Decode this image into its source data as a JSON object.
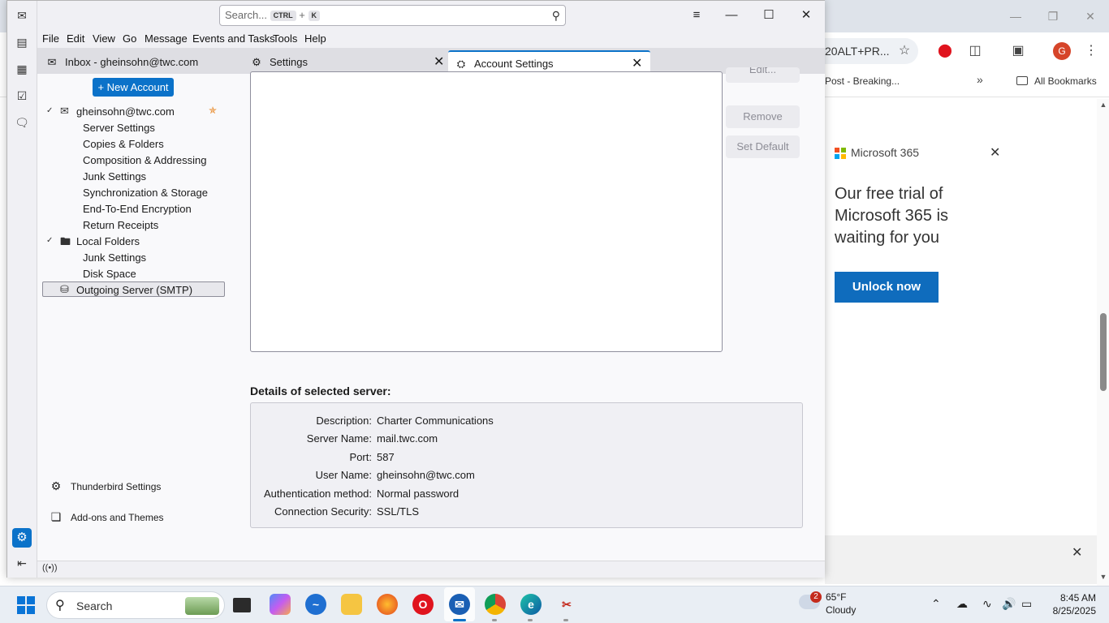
{
  "chrome": {
    "omnibox_text": "20ALT+PR...",
    "bookmark_post": "Post - Breaking...",
    "bookmark_more": "»",
    "bookmark_all": "All Bookmarks",
    "avatar_letter": "G",
    "ad": {
      "brand": "Microsoft 365",
      "headline": "Our free trial of Microsoft 365 is waiting for you",
      "cta": "Unlock now"
    }
  },
  "thunderbird": {
    "search": {
      "placeholder": "Search...",
      "key1": "CTRL",
      "plus": "+",
      "key2": "K"
    },
    "menu": [
      "File",
      "Edit",
      "View",
      "Go",
      "Message",
      "Events and Tasks",
      "Tools",
      "Help"
    ],
    "tabs": [
      {
        "label": "Inbox - gheinsohn@twc.com"
      },
      {
        "label": "Settings"
      },
      {
        "label": "Account Settings"
      }
    ],
    "new_account": "New Account",
    "tree": {
      "account": "gheinsohn@twc.com",
      "account_children": [
        "Server Settings",
        "Copies & Folders",
        "Composition & Addressing",
        "Junk Settings",
        "Synchronization & Storage",
        "End-To-End Encryption",
        "Return Receipts"
      ],
      "local_folders": "Local Folders",
      "local_children": [
        "Junk Settings",
        "Disk Space"
      ],
      "outgoing": "Outgoing Server (SMTP)"
    },
    "bottom_nav": {
      "settings": "Thunderbird Settings",
      "addons": "Add-ons and Themes"
    },
    "buttons": {
      "edit": "Edit...",
      "remove": "Remove",
      "set_default": "Set Default"
    },
    "details": {
      "title": "Details of selected server:",
      "rows": [
        {
          "label": "Description:",
          "value": "Charter Communications"
        },
        {
          "label": "Server Name:",
          "value": "mail.twc.com"
        },
        {
          "label": "Port:",
          "value": "587"
        },
        {
          "label": "User Name:",
          "value": "gheinsohn@twc.com"
        },
        {
          "label": "Authentication method:",
          "value": "Normal password"
        },
        {
          "label": "Connection Security:",
          "value": "SSL/TLS"
        }
      ]
    }
  },
  "taskbar": {
    "search_label": "Search",
    "weather": {
      "badge": "2",
      "temp": "65°F",
      "condition": "Cloudy"
    },
    "time": "8:45 AM",
    "date": "8/25/2025"
  },
  "colors": {
    "accent": "#0b72c9",
    "ms_button": "#0f6cbd",
    "star": "#e8821a"
  }
}
